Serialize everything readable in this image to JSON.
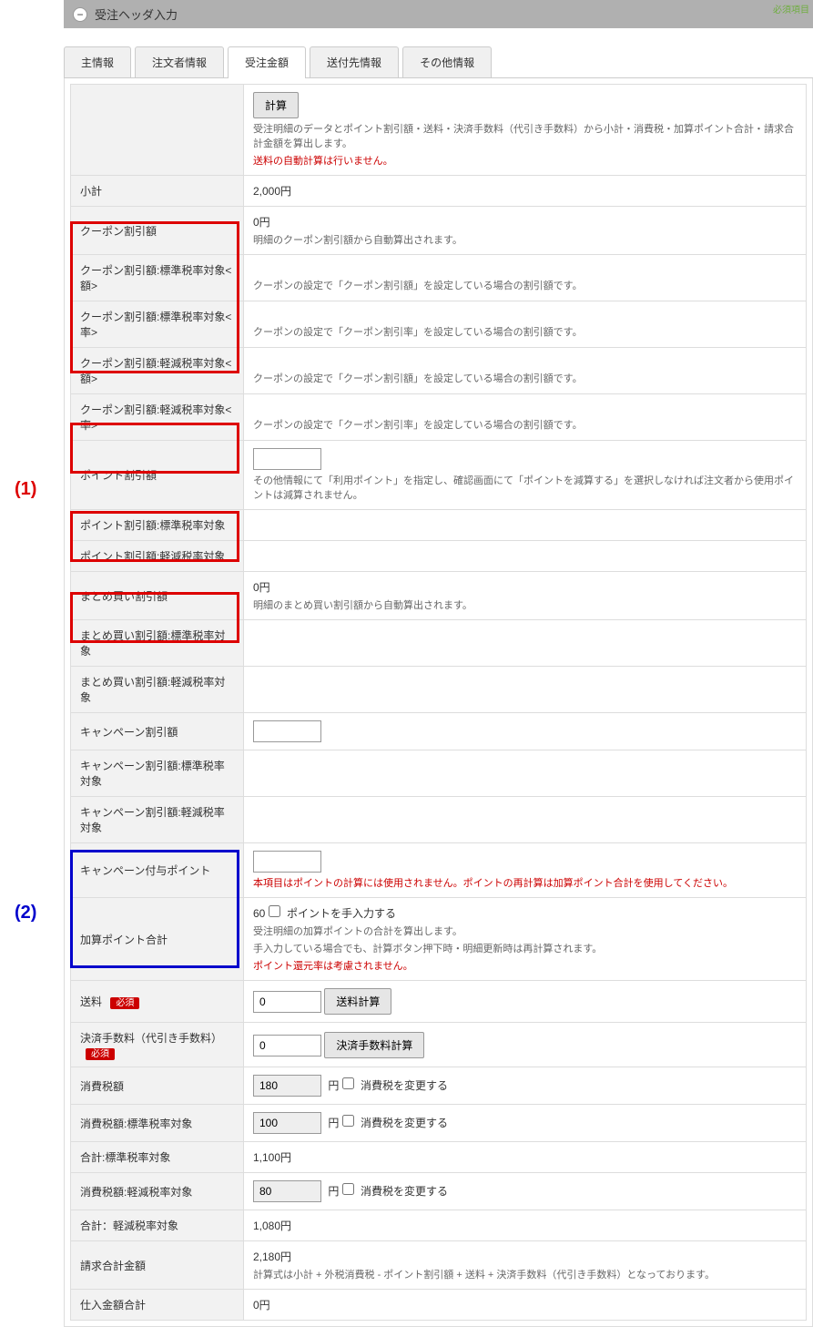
{
  "topright": "必須項目",
  "header": {
    "title": "受注ヘッダ入力"
  },
  "tabs": {
    "main": "主情報",
    "orderer": "注文者情報",
    "amount": "受注金額",
    "delivery": "送付先情報",
    "other": "その他情報"
  },
  "annotations": {
    "a1": "(1)",
    "a2": "(2)"
  },
  "rows": {
    "calc": {
      "btn": "計算",
      "note1": "受注明細のデータとポイント割引額・送料・決済手数料（代引き手数料）から小計・消費税・加算ポイント合計・請求合計金額を算出します。",
      "note2": "送料の自動計算は行いません。"
    },
    "subtotal": {
      "label": "小計",
      "value": "2,000円"
    },
    "coupon": {
      "label": "クーポン割引額",
      "value": "0円",
      "note": "明細のクーポン割引額から自動算出されます。"
    },
    "coupon_std_amt": {
      "label": "クーポン割引額:標準税率対象<額>",
      "note": "クーポンの設定で「クーポン割引額」を設定している場合の割引額です。"
    },
    "coupon_std_rate": {
      "label": "クーポン割引額:標準税率対象<率>",
      "note": "クーポンの設定で「クーポン割引率」を設定している場合の割引額です。"
    },
    "coupon_red_amt": {
      "label": "クーポン割引額:軽減税率対象<額>",
      "note": "クーポンの設定で「クーポン割引額」を設定している場合の割引額です。"
    },
    "coupon_red_rate": {
      "label": "クーポン割引額:軽減税率対象<率>",
      "note": "クーポンの設定で「クーポン割引率」を設定している場合の割引額です。"
    },
    "point_discount": {
      "label": "ポイント割引額",
      "value": "",
      "note": "その他情報にて「利用ポイント」を指定し、確認画面にて「ポイントを減算する」を選択しなければ注文者から使用ポイントは減算されません。"
    },
    "point_std": {
      "label": "ポイント割引額:標準税率対象"
    },
    "point_red": {
      "label": "ポイント割引額:軽減税率対象"
    },
    "bulk": {
      "label": "まとめ買い割引額",
      "value": "0円",
      "note": "明細のまとめ買い割引額から自動算出されます。"
    },
    "bulk_std": {
      "label": "まとめ買い割引額:標準税率対象"
    },
    "bulk_red": {
      "label": "まとめ買い割引額:軽減税率対象"
    },
    "campaign": {
      "label": "キャンペーン割引額",
      "value": ""
    },
    "campaign_std": {
      "label": "キャンペーン割引額:標準税率対象"
    },
    "campaign_red": {
      "label": "キャンペーン割引額:軽減税率対象"
    },
    "campaign_point": {
      "label": "キャンペーン付与ポイント",
      "value": "",
      "note": "本項目はポイントの計算には使用されません。ポイントの再計算は加算ポイント合計を使用してください。"
    },
    "add_point": {
      "label": "加算ポイント合計",
      "value": "60",
      "check_label": "ポイントを手入力する",
      "note1": "受注明細の加算ポイントの合計を算出します。",
      "note2": "手入力している場合でも、計算ボタン押下時・明細更新時は再計算されます。",
      "note3": "ポイント還元率は考慮されません。"
    },
    "shipping": {
      "label": "送料",
      "required": "必須",
      "value": "0",
      "btn": "送料計算"
    },
    "fee": {
      "label": "決済手数料（代引き手数料）",
      "required": "必須",
      "value": "0",
      "btn": "決済手数料計算"
    },
    "tax": {
      "label": "消費税額",
      "value": "180",
      "unit": "円",
      "check_label": "消費税を変更する"
    },
    "tax_std": {
      "label": "消費税額:標準税率対象",
      "value": "100",
      "unit": "円",
      "check_label": "消費税を変更する"
    },
    "total_std": {
      "label": "合計:標準税率対象",
      "value": "1,100円"
    },
    "tax_red": {
      "label": "消費税額:軽減税率対象",
      "value": "80",
      "unit": "円",
      "check_label": "消費税を変更する"
    },
    "total_red": {
      "label": "合計：軽減税率対象",
      "value": "1,080円"
    },
    "grand_total": {
      "label": "請求合計金額",
      "value": "2,180円",
      "note": "計算式は小計 + 外税消費税 - ポイント割引額 + 送料 + 決済手数料（代引き手数料）となっております。"
    },
    "cost_total": {
      "label": "仕入金額合計",
      "value": "0円"
    }
  }
}
